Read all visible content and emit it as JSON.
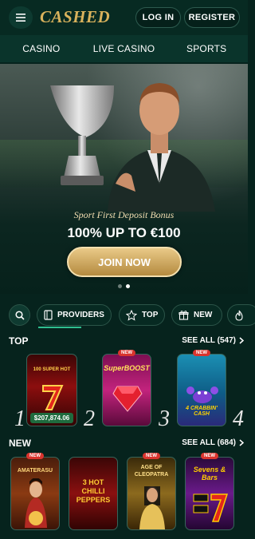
{
  "header": {
    "logo": "CASHED",
    "login_label": "LOG IN",
    "register_label": "REGISTER"
  },
  "topnav": {
    "items": [
      "CASINO",
      "LIVE CASINO",
      "SPORTS"
    ]
  },
  "banner": {
    "subtitle": "Sport First Deposit Bonus",
    "headline": "100% UP TO €100",
    "cta_label": "JOIN NOW",
    "slides": 2,
    "active_slide": 2
  },
  "filters": {
    "providers_label": "PROVIDERS",
    "top_label": "TOP",
    "new_label": "NEW"
  },
  "top_section": {
    "title": "TOP",
    "see_all": "SEE ALL (547)",
    "games": [
      {
        "rank": "1",
        "title": "100 SUPER HOT",
        "jackpot": "$207,874.06",
        "new": false
      },
      {
        "rank": "2",
        "title": "SuperBOOST",
        "new": true
      },
      {
        "rank": "3",
        "title": "4 CRABBIN' CASH",
        "new": true
      },
      {
        "rank": "4"
      }
    ]
  },
  "new_section": {
    "title": "NEW",
    "see_all": "SEE ALL (684)",
    "games": [
      {
        "title": "AMATERASU",
        "new": true
      },
      {
        "title": "3 HOT CHILLI PEPPERS",
        "new": false
      },
      {
        "title": "AGE OF CLEOPATRA",
        "new": true
      },
      {
        "title": "Sevens & Bars",
        "new": true
      }
    ]
  },
  "badge_new": "NEW",
  "colors": {
    "background": "#06231d",
    "accent_gold": "#d9b25c",
    "accent_green": "#2fbf8f",
    "badge_red": "#d9342e"
  }
}
